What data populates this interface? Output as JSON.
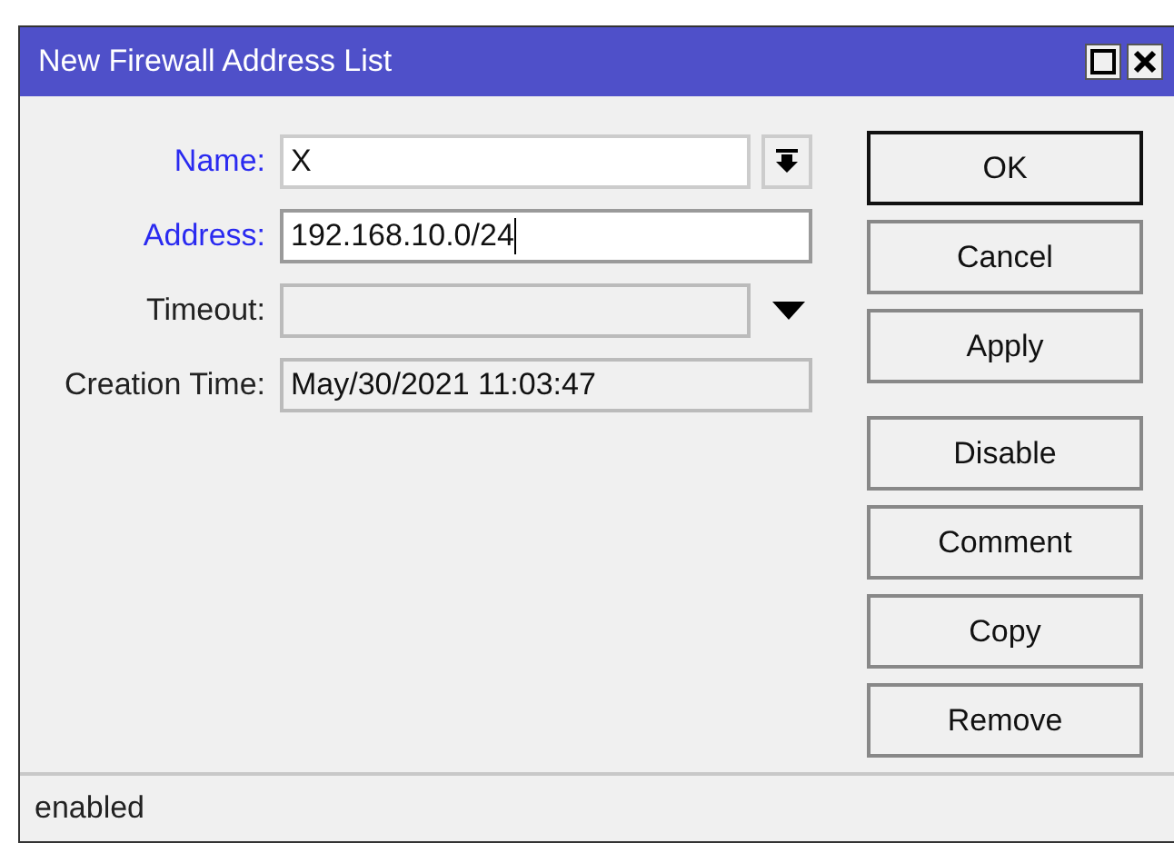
{
  "window": {
    "title": "New Firewall Address List"
  },
  "fields": [
    {
      "label": "Name:",
      "changed": true,
      "kind": "combo",
      "value": "X",
      "focused": false
    },
    {
      "label": "Address:",
      "changed": true,
      "kind": "text",
      "value": "192.168.10.0/24",
      "focused": true
    },
    {
      "label": "Timeout:",
      "changed": false,
      "kind": "dropdown",
      "focused": false
    },
    {
      "label": "Creation Time:",
      "changed": false,
      "kind": "readonly",
      "value": "May/30/2021 11:03:47",
      "focused": false
    }
  ],
  "primary_buttons": [
    {
      "label": "OK",
      "default": true
    },
    {
      "label": "Cancel",
      "default": false
    },
    {
      "label": "Apply",
      "default": false
    }
  ],
  "item_buttons": [
    {
      "label": "Disable"
    },
    {
      "label": "Comment"
    },
    {
      "label": "Copy"
    },
    {
      "label": "Remove"
    }
  ],
  "status_bar": {
    "text": "enabled"
  }
}
